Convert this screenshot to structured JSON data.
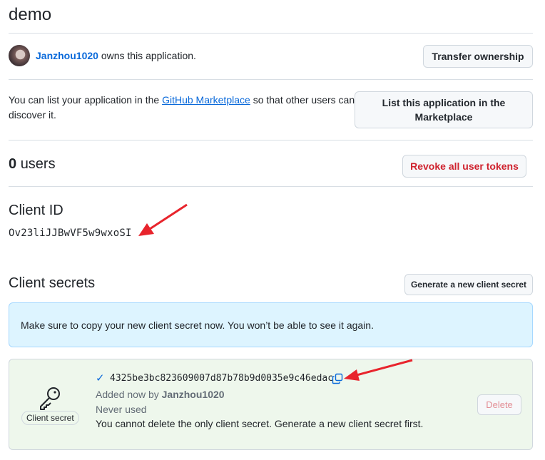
{
  "app": {
    "title": "demo"
  },
  "owner": {
    "username": "Janzhou1020",
    "suffix": "owns this application.",
    "transfer_label": "Transfer ownership"
  },
  "marketplace": {
    "text_before": "You can list your application in the",
    "link": "GitHub Marketplace",
    "text_after": "so that other users can discover it.",
    "button_line1": "List this application in the",
    "button_line2": "Marketplace"
  },
  "users": {
    "count": "0",
    "label": "users",
    "revoke_label": "Revoke all user tokens"
  },
  "client_id": {
    "heading": "Client ID",
    "value": "Ov23liJJBwVF5w9wxoSI"
  },
  "client_secrets": {
    "heading": "Client secrets",
    "generate_label": "Generate a new client secret",
    "flash": "Make sure to copy your new client secret now. You won’t be able to see it again.",
    "secret": {
      "badge": "Client secret",
      "value": "4325be3bc823609007d87b78b9d0035e9c46edac",
      "added_prefix": "Added now by",
      "added_by": "Janzhou1020",
      "usage": "Never used",
      "warning": "You cannot delete the only client secret. Generate a new client secret first.",
      "delete_label": "Delete"
    }
  },
  "colors": {
    "link": "#0969da",
    "danger": "#cf222e",
    "flash_bg": "#ddf4ff",
    "secret_bg": "#eef7ec",
    "annotation_arrow": "#e8242c"
  },
  "icons": [
    "check-icon",
    "copy-icon",
    "key-icon",
    "annotation-arrow"
  ]
}
